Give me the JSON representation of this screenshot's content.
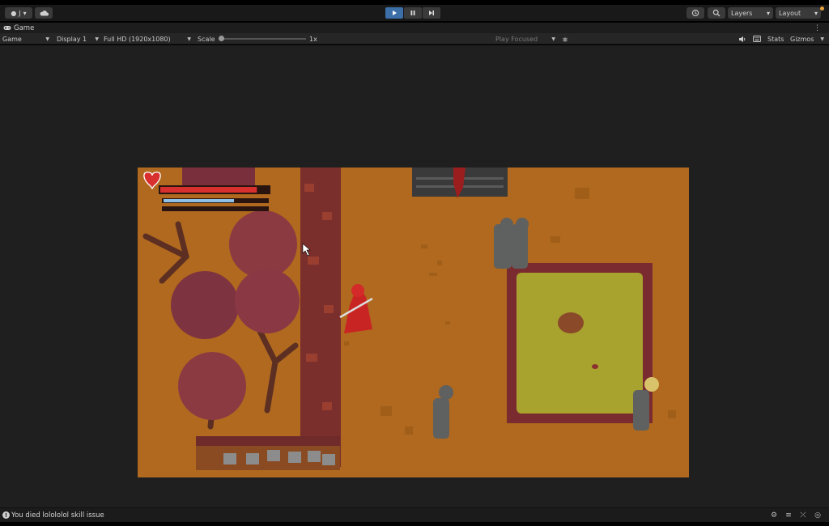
{
  "toolbar": {
    "account_initial": "J",
    "account_caret": "▾",
    "layers_label": "Layers",
    "layout_label": "Layout",
    "dropdown_caret": "▾"
  },
  "tab": {
    "title": "Game",
    "menu_glyph": "⋮"
  },
  "gamebar": {
    "game_view_select": "Game",
    "display_select": "Display 1",
    "resolution_select": "Full HD (1920x1080)",
    "scale_label": "Scale",
    "scale_value": "1x",
    "scale_level": 0,
    "play_mode_select": "Play Focused",
    "stats_label": "Stats",
    "gizmos_label": "Gizmos"
  },
  "game": {
    "health_fraction": 0.89,
    "mana_fraction": 0.68,
    "stamina_fraction": 0.0
  },
  "status": {
    "message": "You died lolololol skill issue"
  },
  "colors": {
    "accent_play": "#3c6ea8",
    "game_ground": "#b0691e",
    "health_red": "#d8302f",
    "mana_blue": "#8fc0e8",
    "foliage": "#8c3a42",
    "pond": "#a8a32e"
  }
}
